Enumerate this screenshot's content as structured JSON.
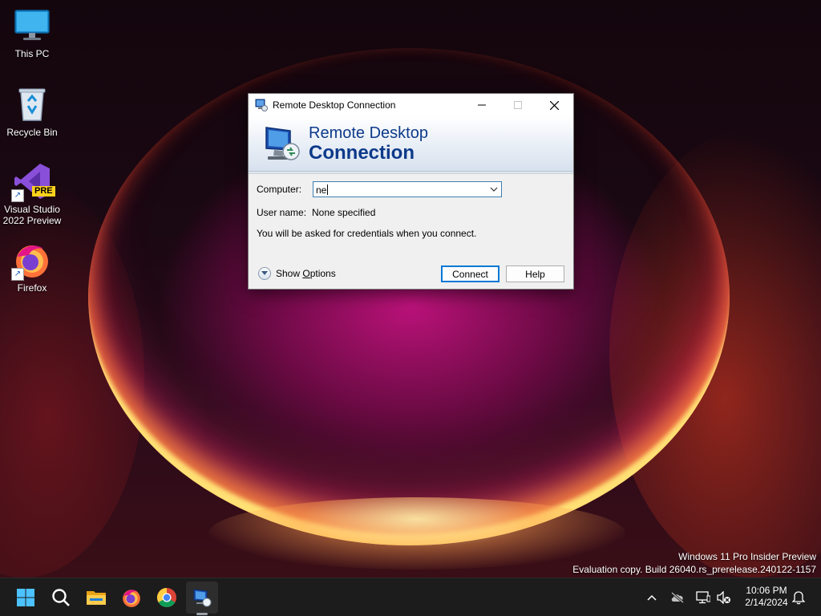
{
  "desktop": {
    "icons": [
      {
        "label": "This PC",
        "icon": "monitor-icon"
      },
      {
        "label": "Recycle Bin",
        "icon": "recycle-bin-icon"
      },
      {
        "label": "Visual Studio 2022 Preview",
        "icon": "visual-studio-icon",
        "badge": "PRE"
      },
      {
        "label": "Firefox",
        "icon": "firefox-icon"
      }
    ]
  },
  "watermark": {
    "line1": "Windows 11 Pro Insider Preview",
    "line2": "Evaluation copy. Build 26040.rs_prerelease.240122-1157"
  },
  "dialog": {
    "title": "Remote Desktop Connection",
    "banner_line1": "Remote Desktop",
    "banner_line2": "Connection",
    "computer_label": "Computer:",
    "computer_value": "ne",
    "username_label": "User name:",
    "username_value": "None specified",
    "info_text": "You will be asked for credentials when you connect.",
    "show_options_prefix": "Show ",
    "show_options_accel": "O",
    "show_options_suffix": "ptions",
    "connect_label": "Connect",
    "help_label": "Help"
  },
  "taskbar": {
    "items": [
      "start-icon",
      "search-icon",
      "file-explorer-icon",
      "firefox-icon",
      "chrome-icon",
      "remote-desktop-icon"
    ],
    "active_item": "remote-desktop-icon",
    "tray": [
      "chevron-up-icon",
      "onedrive-icon",
      "network-icon",
      "volume-muted-icon"
    ],
    "time": "10:06 PM",
    "date": "2/14/2024"
  },
  "colors": {
    "accent": "#0078d7",
    "banner_text": "#0d3a8a",
    "taskbar": "#1c1c1c"
  }
}
